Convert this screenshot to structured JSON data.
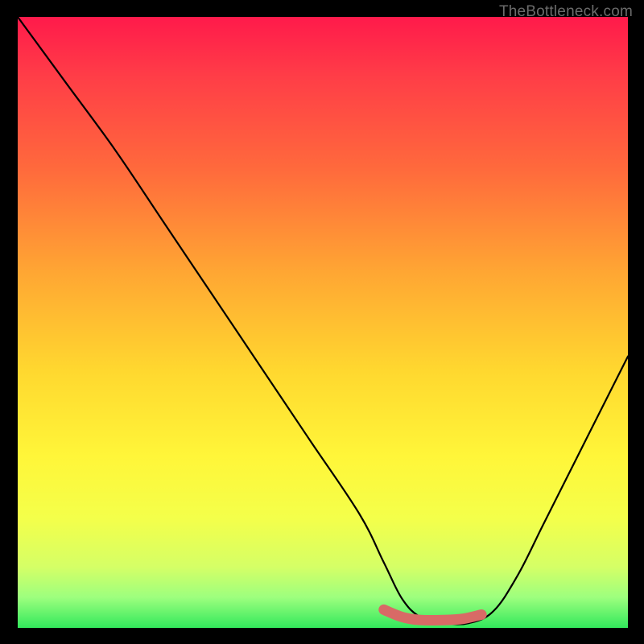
{
  "watermark": "TheBottleneck.com",
  "chart_data": {
    "type": "line",
    "title": "",
    "xlabel": "",
    "ylabel": "",
    "xlim": [
      0,
      100
    ],
    "ylim": [
      0,
      100
    ],
    "series": [
      {
        "name": "bottleneck-curve",
        "x": [
          0,
          8,
          16,
          24,
          32,
          40,
          48,
          56,
          60,
          63,
          66,
          70,
          74,
          78,
          82,
          86,
          90,
          94,
          100
        ],
        "values": [
          100,
          89,
          78,
          66,
          54,
          42,
          30,
          18,
          10,
          4,
          1,
          0,
          0,
          2,
          8,
          16,
          24,
          32,
          44
        ]
      },
      {
        "name": "highlight-band",
        "x": [
          60,
          63,
          66,
          70,
          73,
          76
        ],
        "values": [
          2.2,
          1.0,
          0.5,
          0.5,
          0.7,
          1.4
        ]
      }
    ],
    "gradient_stops": [
      {
        "pos": 0,
        "color": "#ff1a4b"
      },
      {
        "pos": 25,
        "color": "#ff6a3c"
      },
      {
        "pos": 58,
        "color": "#ffd82f"
      },
      {
        "pos": 82,
        "color": "#f4ff4a"
      },
      {
        "pos": 100,
        "color": "#32e85c"
      }
    ]
  }
}
